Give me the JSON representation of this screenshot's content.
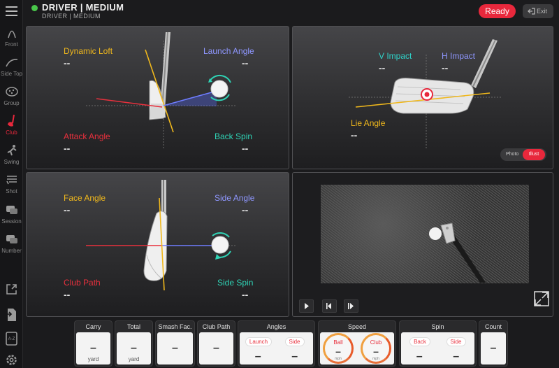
{
  "header": {
    "title": "DRIVER | MEDIUM",
    "subtitle": "DRIVER | MEDIUM",
    "ready_label": "Ready",
    "exit_label": "Exit",
    "status_color": "#49c64a"
  },
  "sidebar": {
    "items": [
      {
        "label": "Front",
        "icon": "front-arc-icon"
      },
      {
        "label": "Side Top",
        "icon": "side-top-arc-icon"
      },
      {
        "label": "Group",
        "icon": "group-icon"
      },
      {
        "label": "Club",
        "icon": "club-icon",
        "active": true
      },
      {
        "label": "Swing",
        "icon": "swing-icon"
      },
      {
        "label": "Shot",
        "icon": "shot-list-icon"
      },
      {
        "label": "Session",
        "icon": "session-icon"
      },
      {
        "label": "Number",
        "icon": "number-icon"
      }
    ],
    "bottom_icons": [
      "export-icon",
      "document-icon",
      "report-icon",
      "settings-icon"
    ]
  },
  "panels": {
    "driver_front": {
      "dynamic_loft": {
        "label": "Dynamic Loft",
        "value": "--"
      },
      "launch_angle": {
        "label": "Launch Angle",
        "value": "--"
      },
      "attack_angle": {
        "label": "Attack Angle",
        "value": "--"
      },
      "back_spin": {
        "label": "Back Spin",
        "value": "--"
      }
    },
    "iron_impact": {
      "v_impact": {
        "label": "V Impact",
        "value": "--"
      },
      "h_impact": {
        "label": "H Impact",
        "value": "--"
      },
      "lie_angle": {
        "label": "Lie Angle",
        "value": "--"
      },
      "toggle": {
        "photo": "Photo",
        "illust": "Illust"
      }
    },
    "top_view": {
      "face_angle": {
        "label": "Face Angle",
        "value": "--"
      },
      "side_angle": {
        "label": "Side Angle",
        "value": "--"
      },
      "club_path": {
        "label": "Club Path",
        "value": "--"
      },
      "side_spin": {
        "label": "Side Spin",
        "value": "--"
      }
    },
    "video": {
      "controls": [
        "play-icon",
        "step-back-icon",
        "step-forward-icon"
      ],
      "expand_icon": "expand-icon"
    }
  },
  "stats": {
    "carry": {
      "label": "Carry",
      "value": "–",
      "unit": "yard"
    },
    "total": {
      "label": "Total",
      "value": "–",
      "unit": "yard"
    },
    "smash": {
      "label": "Smash Fac.",
      "value": "–"
    },
    "club_path": {
      "label": "Club Path",
      "value": "–"
    },
    "angles": {
      "label": "Angles",
      "launch": "Launch",
      "side": "Side",
      "launch_value": "–",
      "side_value": "–"
    },
    "speed": {
      "label": "Speed",
      "ball": "Ball",
      "club": "Club",
      "ball_value": "–",
      "club_value": "–",
      "unit": "mph"
    },
    "spin": {
      "label": "Spin",
      "back": "Back",
      "side": "Side",
      "back_value": "–",
      "side_value": "–"
    },
    "count": {
      "label": "Count",
      "value": "–"
    }
  },
  "colors": {
    "accent": "#e8283c",
    "yellow": "#f0b81c",
    "blue": "#8f97ff",
    "red": "#e8303d",
    "teal": "#2fd3b5"
  }
}
